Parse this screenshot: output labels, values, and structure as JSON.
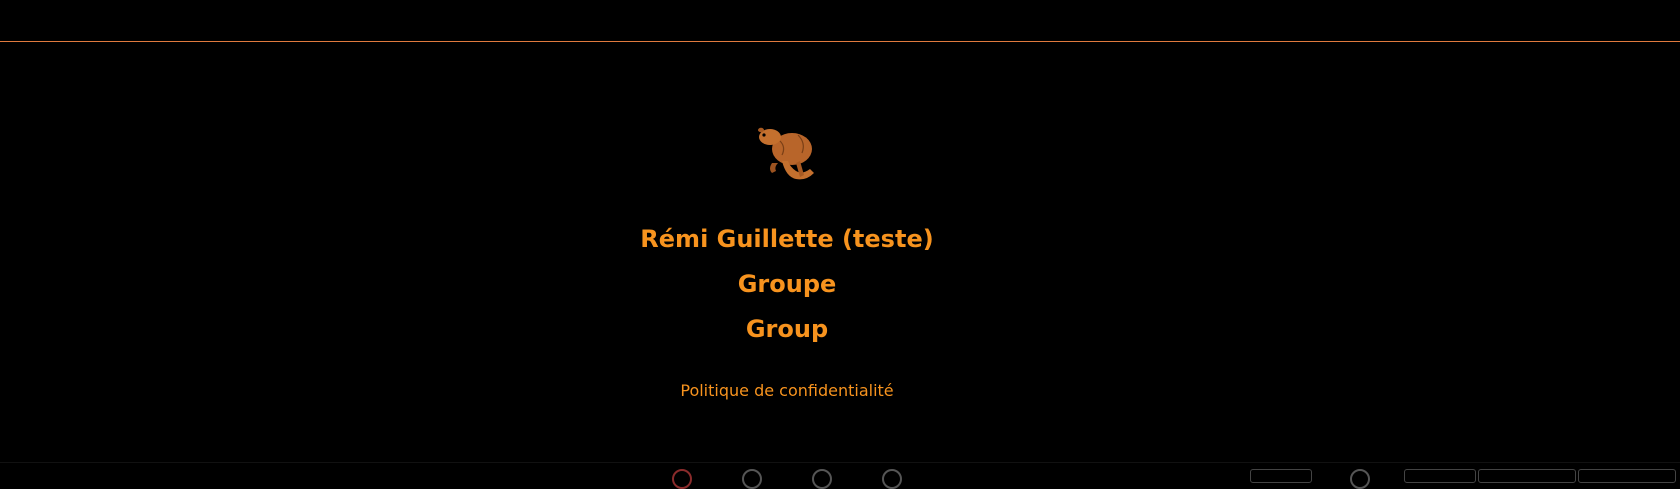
{
  "footer": {
    "logo_name": "beaver-logo",
    "name": "Rémi Guillette (teste)",
    "group_fr": "Groupe",
    "group_en": "Group",
    "privacy_link": "Politique de confidentialité"
  },
  "colors": {
    "background": "#000000",
    "accent": "#f7931e",
    "rule": "#e07a3e"
  }
}
